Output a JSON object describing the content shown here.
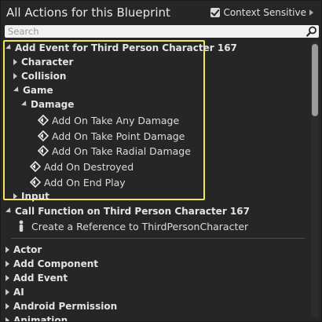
{
  "header": {
    "title": "All Actions for this Blueprint",
    "context_sensitive_label": "Context Sensitive",
    "context_sensitive_checked": true
  },
  "search": {
    "placeholder": "Search",
    "value": ""
  },
  "tree": {
    "add_event_category": "Add Event for Third Person Character 167",
    "character": "Character",
    "collision": "Collision",
    "game": "Game",
    "damage": "Damage",
    "take_any_damage": "Add On Take Any Damage",
    "take_point_damage": "Add On Take Point Damage",
    "take_radial_damage": "Add On Take Radial Damage",
    "on_destroyed": "Add On Destroyed",
    "on_end_play": "Add On End Play",
    "input": "Input",
    "call_function_category": "Call Function on Third Person Character 167",
    "create_reference": "Create a Reference to ThirdPersonCharacter",
    "actor": "Actor",
    "add_component": "Add Component",
    "add_event": "Add Event",
    "ai": "AI",
    "android_permission": "Android Permission",
    "animation": "Animation"
  },
  "colors": {
    "highlight_border": "#f2e65a",
    "background": "#262626",
    "text": "#d8d8d8"
  }
}
